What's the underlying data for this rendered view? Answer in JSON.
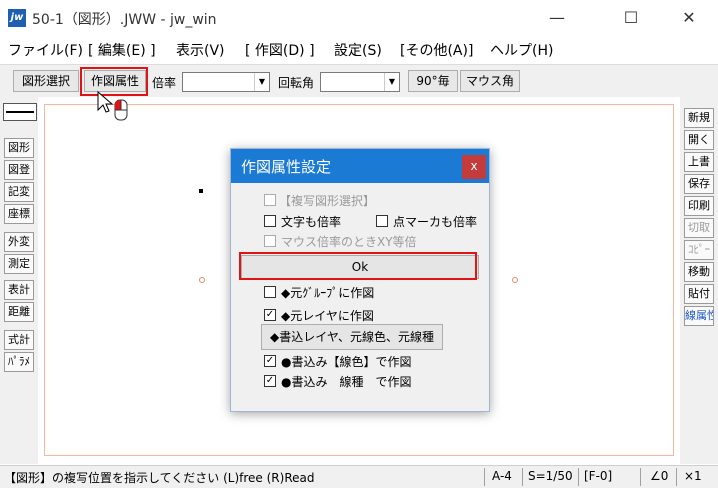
{
  "window": {
    "title": "50-1（図形）.JWW - jw_win",
    "icon_text": "jw",
    "minimize": "—",
    "maximize": "☐",
    "close": "✕"
  },
  "menu": [
    "ファイル(F)",
    "[ 編集(E) ]",
    "表示(V)",
    "[ 作図(D) ]",
    "設定(S)",
    "[その他(A)]",
    "ヘルプ(H)"
  ],
  "toolbar": {
    "figure_select": "図形選択",
    "draw_attr": "作図属性",
    "scale_label": "倍率",
    "scale_value": "",
    "rotate_label": "回転角",
    "rotate_value": "",
    "deg90": "90°毎",
    "mouse_angle": "マウス角"
  },
  "left_tools": [
    "図形",
    "図登",
    "記変",
    "座標",
    "外変",
    "測定",
    "表計",
    "距離",
    "式計",
    "ﾊﾟﾗﾒ"
  ],
  "right_tools": [
    {
      "label": "新規",
      "state": "normal"
    },
    {
      "label": "開く",
      "state": "normal"
    },
    {
      "label": "上書",
      "state": "normal"
    },
    {
      "label": "保存",
      "state": "normal"
    },
    {
      "label": "印刷",
      "state": "normal"
    },
    {
      "label": "切取",
      "state": "disabled"
    },
    {
      "label": "ｺﾋﾟｰ",
      "state": "disabled"
    },
    {
      "label": "移動",
      "state": "normal"
    },
    {
      "label": "貼付",
      "state": "normal"
    },
    {
      "label": "線属性",
      "state": "active"
    }
  ],
  "status": {
    "message": "【図形】の複写位置を指示してください (L)free (R)Read",
    "paper": "A-4",
    "scale": "S=1/50",
    "layer": "[F-0]",
    "angle": "∠0",
    "zoom": "×1"
  },
  "dialog": {
    "title": "作図属性設定",
    "close": "x",
    "copy_select": {
      "label": "【複写図形選択】",
      "checked": false,
      "enabled": false
    },
    "text_scale": {
      "label": "文字も倍率",
      "checked": false
    },
    "point_scale": {
      "label": "点マーカも倍率",
      "checked": false
    },
    "mouse_xy": {
      "label": "マウス倍率のときXY等倍",
      "checked": false,
      "enabled": false
    },
    "ok": "Ok",
    "orig_group": {
      "label": "◆元ｸﾞﾙｰﾌﾟに作図",
      "checked": false
    },
    "orig_layer": {
      "label": "◆元レイヤに作図",
      "checked": true
    },
    "write_button": "◆書込レイヤ、元線色、元線種",
    "write_color": {
      "label": "●書込み【線色】で作図",
      "checked": true
    },
    "write_type": {
      "label": "●書込み　線種　で作図",
      "checked": true
    }
  },
  "colors": {
    "accent": "#1b7ad3",
    "highlight": "#e01414",
    "close": "#c43b3b"
  }
}
